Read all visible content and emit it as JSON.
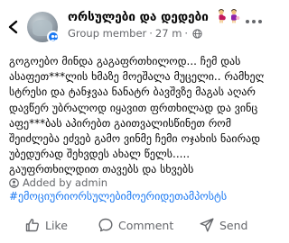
{
  "header": {
    "group_name": "ორსულები და დედები",
    "member_role": "Group member",
    "time_ago": "27 m",
    "separator": "·"
  },
  "post": {
    "lines": [
      "გოგოებო მინდა გაგაფრთხილოდ... ჩემ დას",
      "ასაფეთ***ლის ხმაზე მოეშალა მუცელი.. რამხელა",
      "სტრესი და ტანჯვაა ნანატრ ბავშვზე მაგას აღარ",
      "დავწერ უბრალოდ იყავით ფრთხილად და ვინც",
      "აფე***ბას აპირებთ გაითვალისწინეთ რომ",
      "შეიძლება ეძვებ გამო ვინმე ჩემი ოჯახის ნაირად",
      "უბედურად შეხვდეს ახალ წელს.....",
      "გაუფრთხილდით თავებს და სხვებს"
    ]
  },
  "admin_note": "Added by admin",
  "hashtag": "#ემოციურიორსულებიმოერიდეთამპოსტს",
  "actions": {
    "like": "Like",
    "comment": "Comment",
    "send": "Send"
  },
  "colors": {
    "accent": "#1877f2",
    "secondary_text": "#65676b",
    "primary_text": "#050505"
  },
  "icons": {
    "back": "chevron-left-icon",
    "badge": "group-icon",
    "globe": "globe-icon",
    "more": "more-dots-icon",
    "admin": "admin-icon",
    "like": "thumbs-up-icon",
    "comment": "comment-icon",
    "send": "send-icon"
  }
}
